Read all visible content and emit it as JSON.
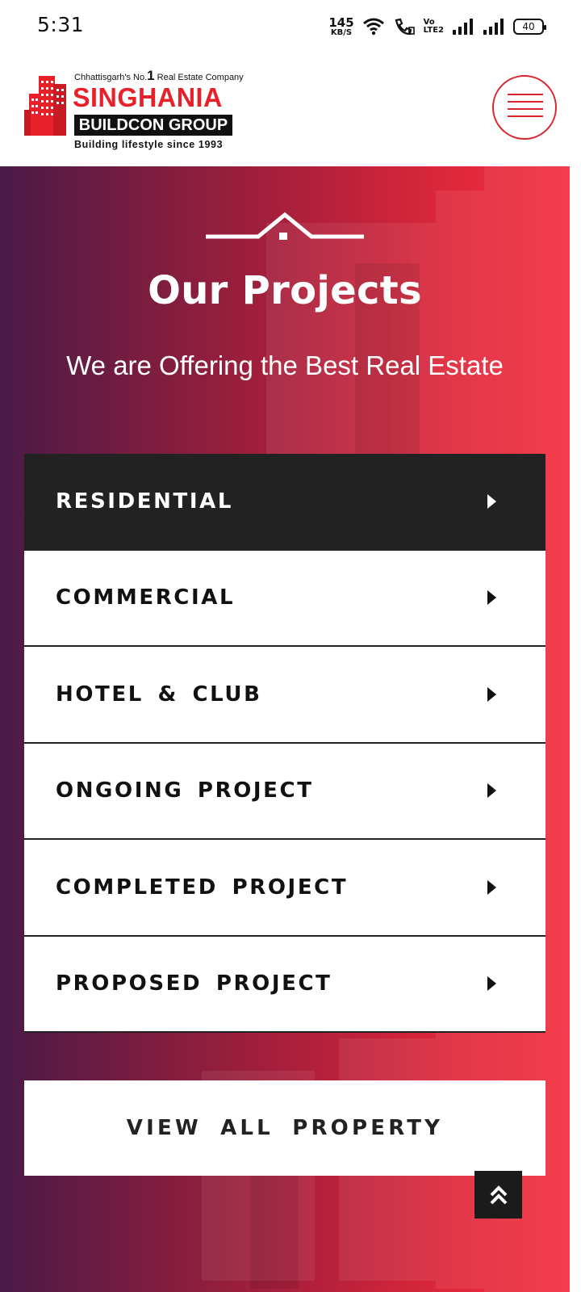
{
  "status_bar": {
    "time": "5:31",
    "net_speed_value": "145",
    "net_speed_unit": "KB/S",
    "volte_top": "Vo",
    "volte_bottom": "LTE2",
    "battery": "40",
    "icons": [
      "wifi-icon",
      "wifi-call-icon",
      "volte-icon",
      "signal-icon",
      "signal-icon",
      "battery-icon"
    ]
  },
  "header": {
    "logo": {
      "tagline_prefix": "Chhattisgarh's No.",
      "tagline_number": "1",
      "tagline_suffix": " Real Estate Company",
      "name": "SINGHANIA",
      "sub_name": "BUILDCON GROUP",
      "slogan": "Building lifestyle since 1993"
    },
    "menu_icon": "hamburger-menu-icon",
    "brand_color": "#e8202a"
  },
  "hero": {
    "icon": "house-divider-icon",
    "title": "Our Projects",
    "subtitle": "We are Offering the Best Real Estate",
    "categories": [
      {
        "label": "RESIDENTIAL",
        "active": true
      },
      {
        "label": "COMMERCIAL",
        "active": false
      },
      {
        "label": "HOTEL & CLUB",
        "active": false
      },
      {
        "label": "ONGOING PROJECT",
        "active": false
      },
      {
        "label": "COMPLETED PROJECT",
        "active": false
      },
      {
        "label": "PROPOSED PROJECT",
        "active": false
      }
    ],
    "view_all_label": "VIEW ALL PROPERTY",
    "scroll_top_icon": "double-chevron-up-icon",
    "colors": {
      "gradient_start": "#4a1a48",
      "gradient_end": "#f42e3e",
      "active_bg": "#222222"
    }
  }
}
